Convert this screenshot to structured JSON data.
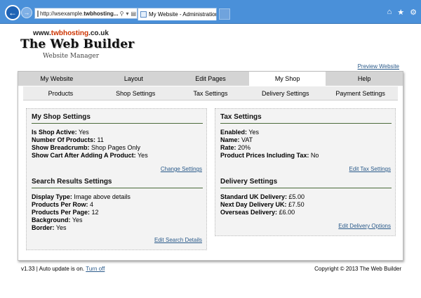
{
  "browser": {
    "address_prefix": "http://wsexample.",
    "address_domain": "twbhosting...",
    "tab_title": "My Website - Administration",
    "tab_close": "×",
    "right_icons": [
      "home-icon",
      "star-icon",
      "gear-icon"
    ]
  },
  "header": {
    "url_www": "www.",
    "url_brand": "twbhosting",
    "url_tld": ".co.uk",
    "title": "The Web Builder",
    "subtitle": "Website Manager",
    "preview_link": "Preview Website"
  },
  "main_tabs": [
    "My Website",
    "Layout",
    "Edit Pages",
    "My Shop",
    "Help"
  ],
  "active_main_tab": "My Shop",
  "sub_tabs": [
    "Products",
    "Shop Settings",
    "Tax Settings",
    "Delivery Settings",
    "Payment Settings"
  ],
  "shop_settings": {
    "title": "My Shop Settings",
    "rows": [
      {
        "label": "Is Shop Active:",
        "value": " Yes"
      },
      {
        "label": "Number Of Products:",
        "value": " 11"
      },
      {
        "label": "Show Breadcrumb:",
        "value": " Shop Pages Only"
      },
      {
        "label": "Show Cart After Adding A Product:",
        "value": " Yes"
      }
    ],
    "link": "Change Settings"
  },
  "search_settings": {
    "title": "Search Results Settings",
    "rows": [
      {
        "label": "Display Type:",
        "value": " Image above details"
      },
      {
        "label": "Products Per Row:",
        "value": " 4"
      },
      {
        "label": "Products Per Page:",
        "value": " 12"
      },
      {
        "label": "Background:",
        "value": " Yes"
      },
      {
        "label": "Border:",
        "value": " Yes"
      }
    ],
    "link": "Edit Search Details"
  },
  "tax_settings": {
    "title": "Tax Settings",
    "rows": [
      {
        "label": "Enabled:",
        "value": " Yes"
      },
      {
        "label": "Name:",
        "value": " VAT"
      },
      {
        "label": "Rate:",
        "value": " 20%"
      },
      {
        "label": "Product Prices Including Tax:",
        "value": " No"
      }
    ],
    "link": "Edit Tax Settings"
  },
  "delivery_settings": {
    "title": "Delivery Settings",
    "rows": [
      {
        "label": "Standard UK Delivery:",
        "value": " £5.00"
      },
      {
        "label": "Next Day Delivery UK:",
        "value": " £7.50"
      },
      {
        "label": "Overseas Delivery:",
        "value": " £6.00"
      }
    ],
    "link": "Edit Delivery Options"
  },
  "footer": {
    "version_text": "v1.33 | Auto update is on. ",
    "turn_off": "Turn off",
    "copyright": "Copyright © 2013 The Web Builder"
  }
}
